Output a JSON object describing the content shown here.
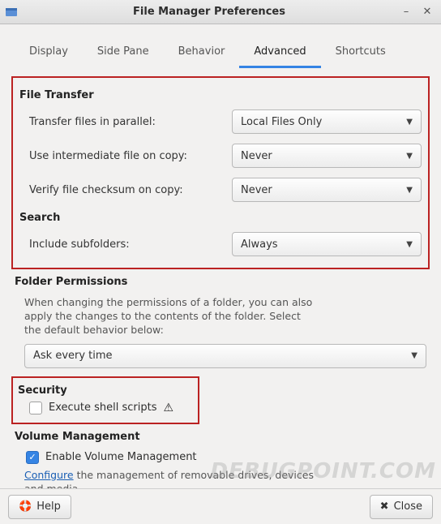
{
  "title": "File Manager Preferences",
  "tabs": {
    "display": "Display",
    "sidepane": "Side Pane",
    "behavior": "Behavior",
    "advanced": "Advanced",
    "shortcuts": "Shortcuts"
  },
  "sections": {
    "file_transfer": {
      "title": "File Transfer",
      "parallel_label": "Transfer files in parallel:",
      "parallel_value": "Local Files Only",
      "intermediate_label": "Use intermediate file on copy:",
      "intermediate_value": "Never",
      "checksum_label": "Verify file checksum on copy:",
      "checksum_value": "Never"
    },
    "search": {
      "title": "Search",
      "subfolders_label": "Include subfolders:",
      "subfolders_value": "Always"
    },
    "folder_permissions": {
      "title": "Folder Permissions",
      "desc": "When changing the permissions of a folder, you can also apply the changes to the contents of the folder. Select the default behavior below:",
      "value": "Ask every time"
    },
    "security": {
      "title": "Security",
      "execute_label": "Execute shell scripts",
      "execute_checked": false
    },
    "volume": {
      "title": "Volume Management",
      "enable_label": "Enable Volume Management",
      "enable_checked": true,
      "configure_link": "Configure",
      "configure_rest": " the management of removable drives, devices and media."
    }
  },
  "footer": {
    "help": "Help",
    "close": "Close"
  },
  "watermark": "DEBUGPOINT.COM"
}
